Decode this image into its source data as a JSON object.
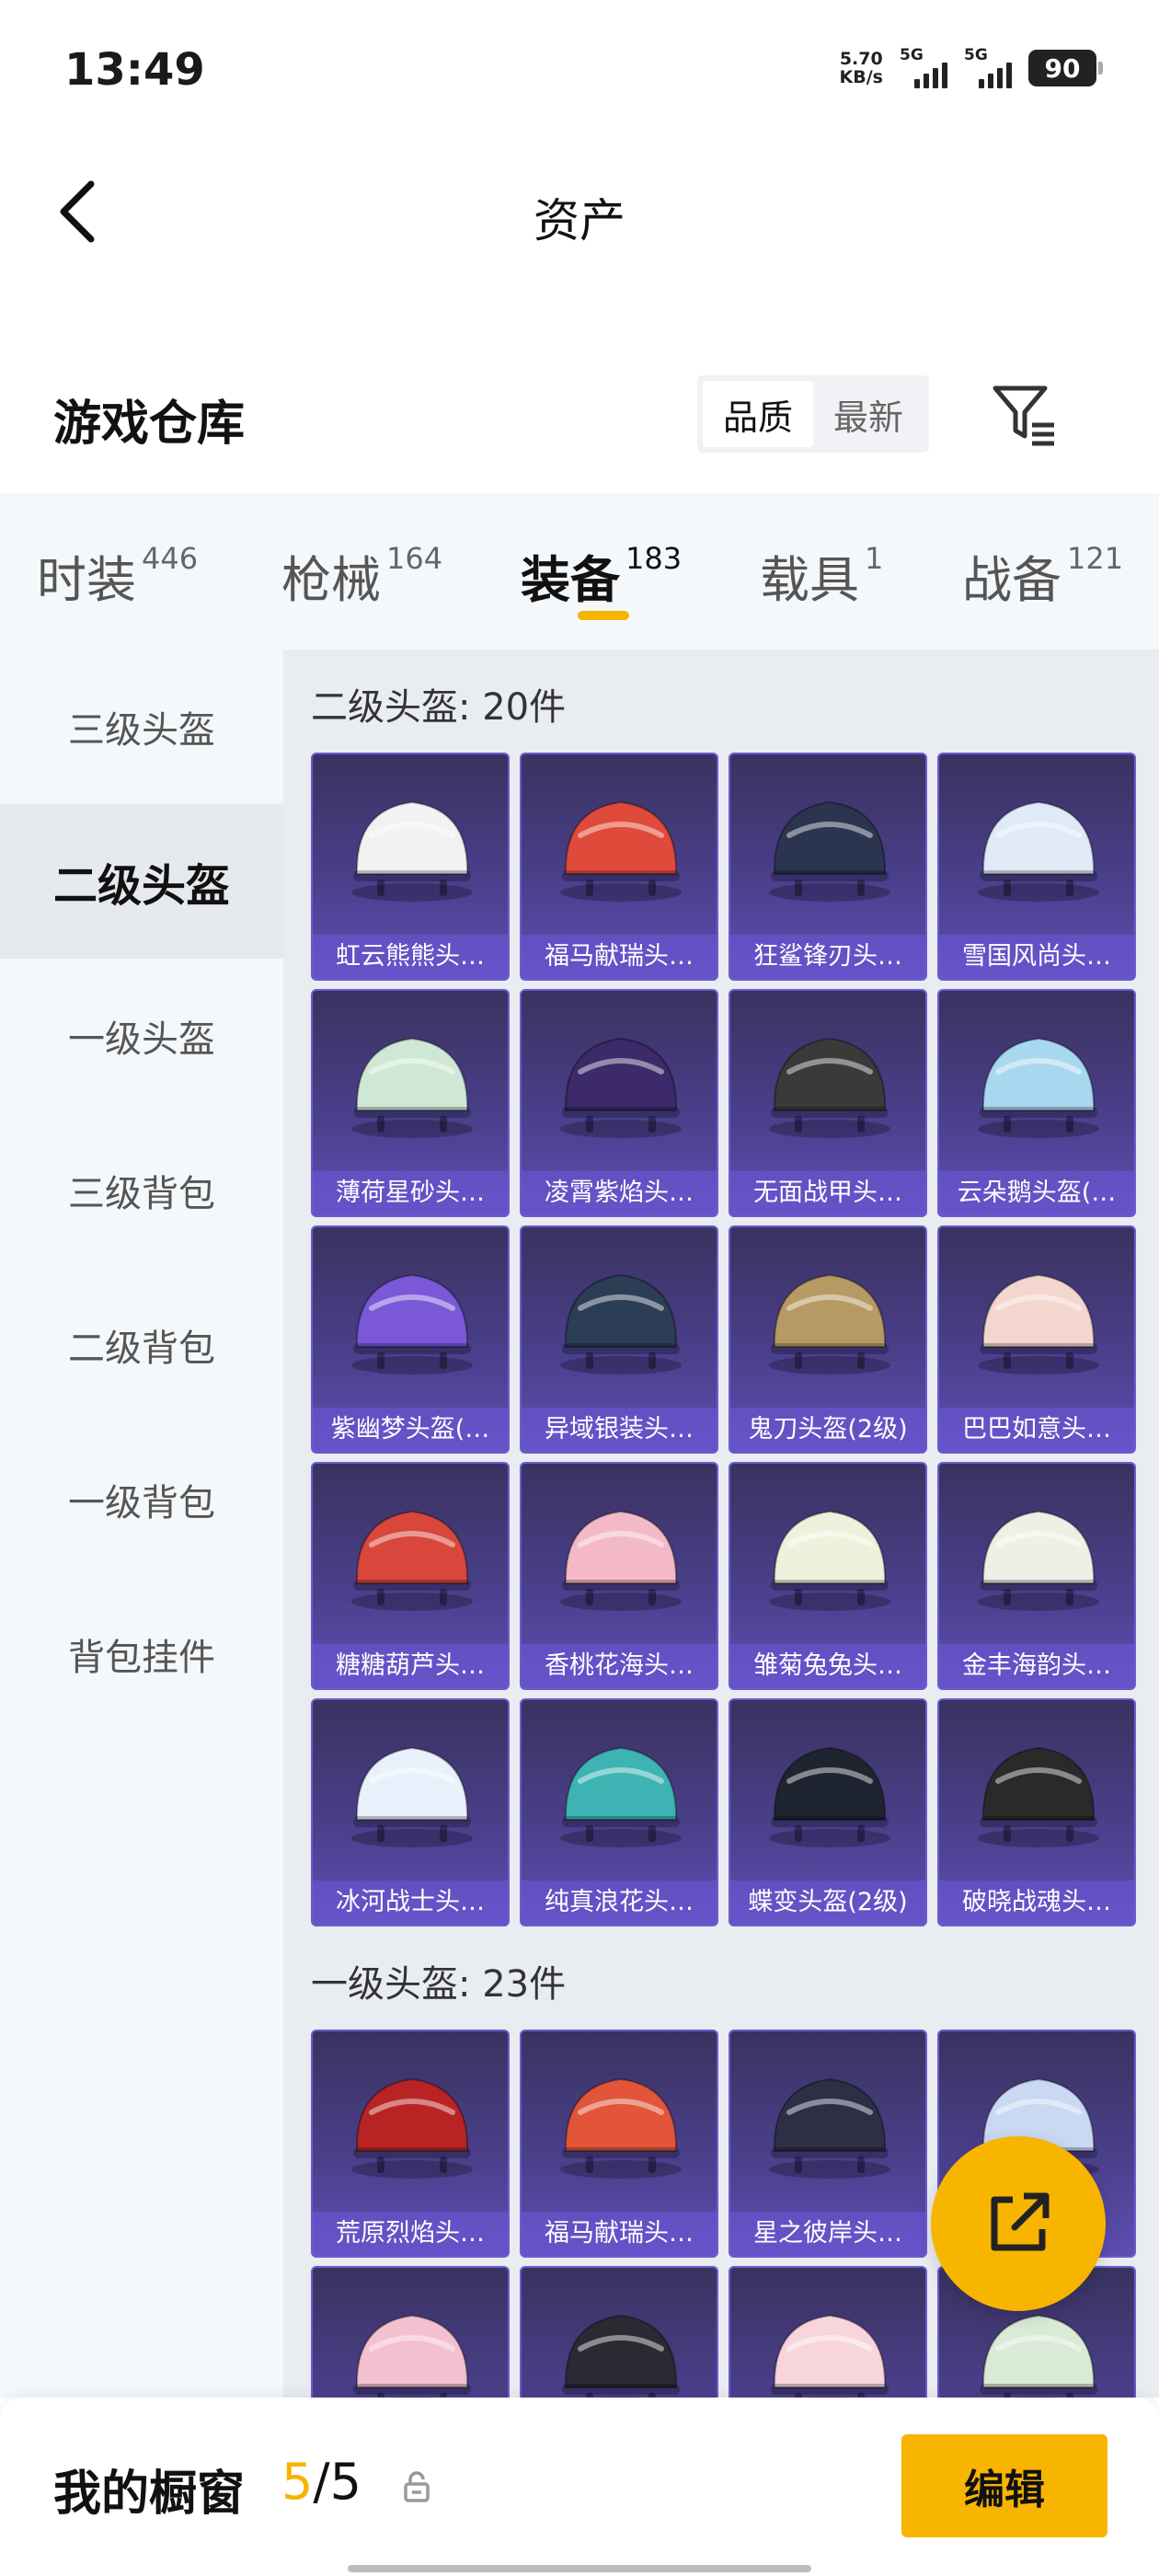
{
  "status": {
    "time": "13:49",
    "net_speed_value": "5.70",
    "net_speed_unit": "KB/s",
    "sim1": "5G",
    "sim2": "5G",
    "battery": "90"
  },
  "header": {
    "title": "资产",
    "back_icon": "chevron-left-icon"
  },
  "warehouse": {
    "title": "游戏仓库",
    "sort_options": [
      {
        "label": "品质",
        "active": true
      },
      {
        "label": "最新",
        "active": false
      }
    ],
    "filter_icon": "filter-list-icon"
  },
  "tabs": [
    {
      "label": "时装",
      "count": "446",
      "active": false
    },
    {
      "label": "枪械",
      "count": "164",
      "active": false
    },
    {
      "label": "装备",
      "count": "183",
      "active": true
    },
    {
      "label": "载具",
      "count": "1",
      "active": false
    },
    {
      "label": "战备",
      "count": "121",
      "active": false
    }
  ],
  "sidebar": {
    "items": [
      {
        "label": "三级头盔",
        "active": false
      },
      {
        "label": "二级头盔",
        "active": true
      },
      {
        "label": "一级头盔",
        "active": false
      },
      {
        "label": "三级背包",
        "active": false
      },
      {
        "label": "二级背包",
        "active": false
      },
      {
        "label": "一级背包",
        "active": false
      },
      {
        "label": "背包挂件",
        "active": false
      }
    ]
  },
  "sections": [
    {
      "title": "二级头盔: 20件",
      "items": [
        {
          "name": "虹云熊熊头…",
          "color": "#f2f2f2"
        },
        {
          "name": "福马献瑞头…",
          "color": "#e04a3a"
        },
        {
          "name": "狂鲨锋刃头…",
          "color": "#2b3550"
        },
        {
          "name": "雪国风尚头…",
          "color": "#dfe9f7"
        },
        {
          "name": "薄荷星砂头…",
          "color": "#cfe8d6"
        },
        {
          "name": "凌霄紫焰头…",
          "color": "#3c2a6a"
        },
        {
          "name": "无面战甲头…",
          "color": "#3a3a3a"
        },
        {
          "name": "云朵鹅头盔(…",
          "color": "#a8d8ef"
        },
        {
          "name": "紫幽梦头盔(…",
          "color": "#7a58d8"
        },
        {
          "name": "异域银装头…",
          "color": "#2c3e55"
        },
        {
          "name": "鬼刀头盔(2级)",
          "color": "#b79a63"
        },
        {
          "name": "巴巴如意头…",
          "color": "#f3d6cf"
        },
        {
          "name": "糖糖葫芦头…",
          "color": "#d9473c"
        },
        {
          "name": "香桃花海头…",
          "color": "#f4b9c6"
        },
        {
          "name": "雏菊兔兔头…",
          "color": "#eef2dc"
        },
        {
          "name": "金丰海韵头…",
          "color": "#eef0e6"
        },
        {
          "name": "冰河战士头…",
          "color": "#e8f1fb"
        },
        {
          "name": "纯真浪花头…",
          "color": "#3db3b3"
        },
        {
          "name": "蝶变头盔(2级)",
          "color": "#1f2530"
        },
        {
          "name": "破晓战魂头…",
          "color": "#2a2a2a"
        }
      ]
    },
    {
      "title": "一级头盔: 23件",
      "items": [
        {
          "name": "荒原烈焰头…",
          "color": "#b82424"
        },
        {
          "name": "福马献瑞头…",
          "color": "#e2553a"
        },
        {
          "name": "星之彼岸头…",
          "color": "#2d2f45"
        },
        {
          "name": "",
          "color": "#c9d8f3"
        },
        {
          "name": "",
          "color": "#f3c0d0"
        },
        {
          "name": "",
          "color": "#2a2a33"
        },
        {
          "name": "",
          "color": "#f8d5dc"
        },
        {
          "name": "",
          "color": "#d9ead6"
        }
      ]
    }
  ],
  "fab": {
    "icon": "share-external-icon"
  },
  "bottom": {
    "window_label": "我的橱窗",
    "current": "5",
    "separator": "/",
    "total": "5",
    "lock_icon": "lock-icon",
    "edit_label": "编辑"
  },
  "colors": {
    "accent": "#f7b500",
    "card_bg": "#4a3f8a"
  }
}
